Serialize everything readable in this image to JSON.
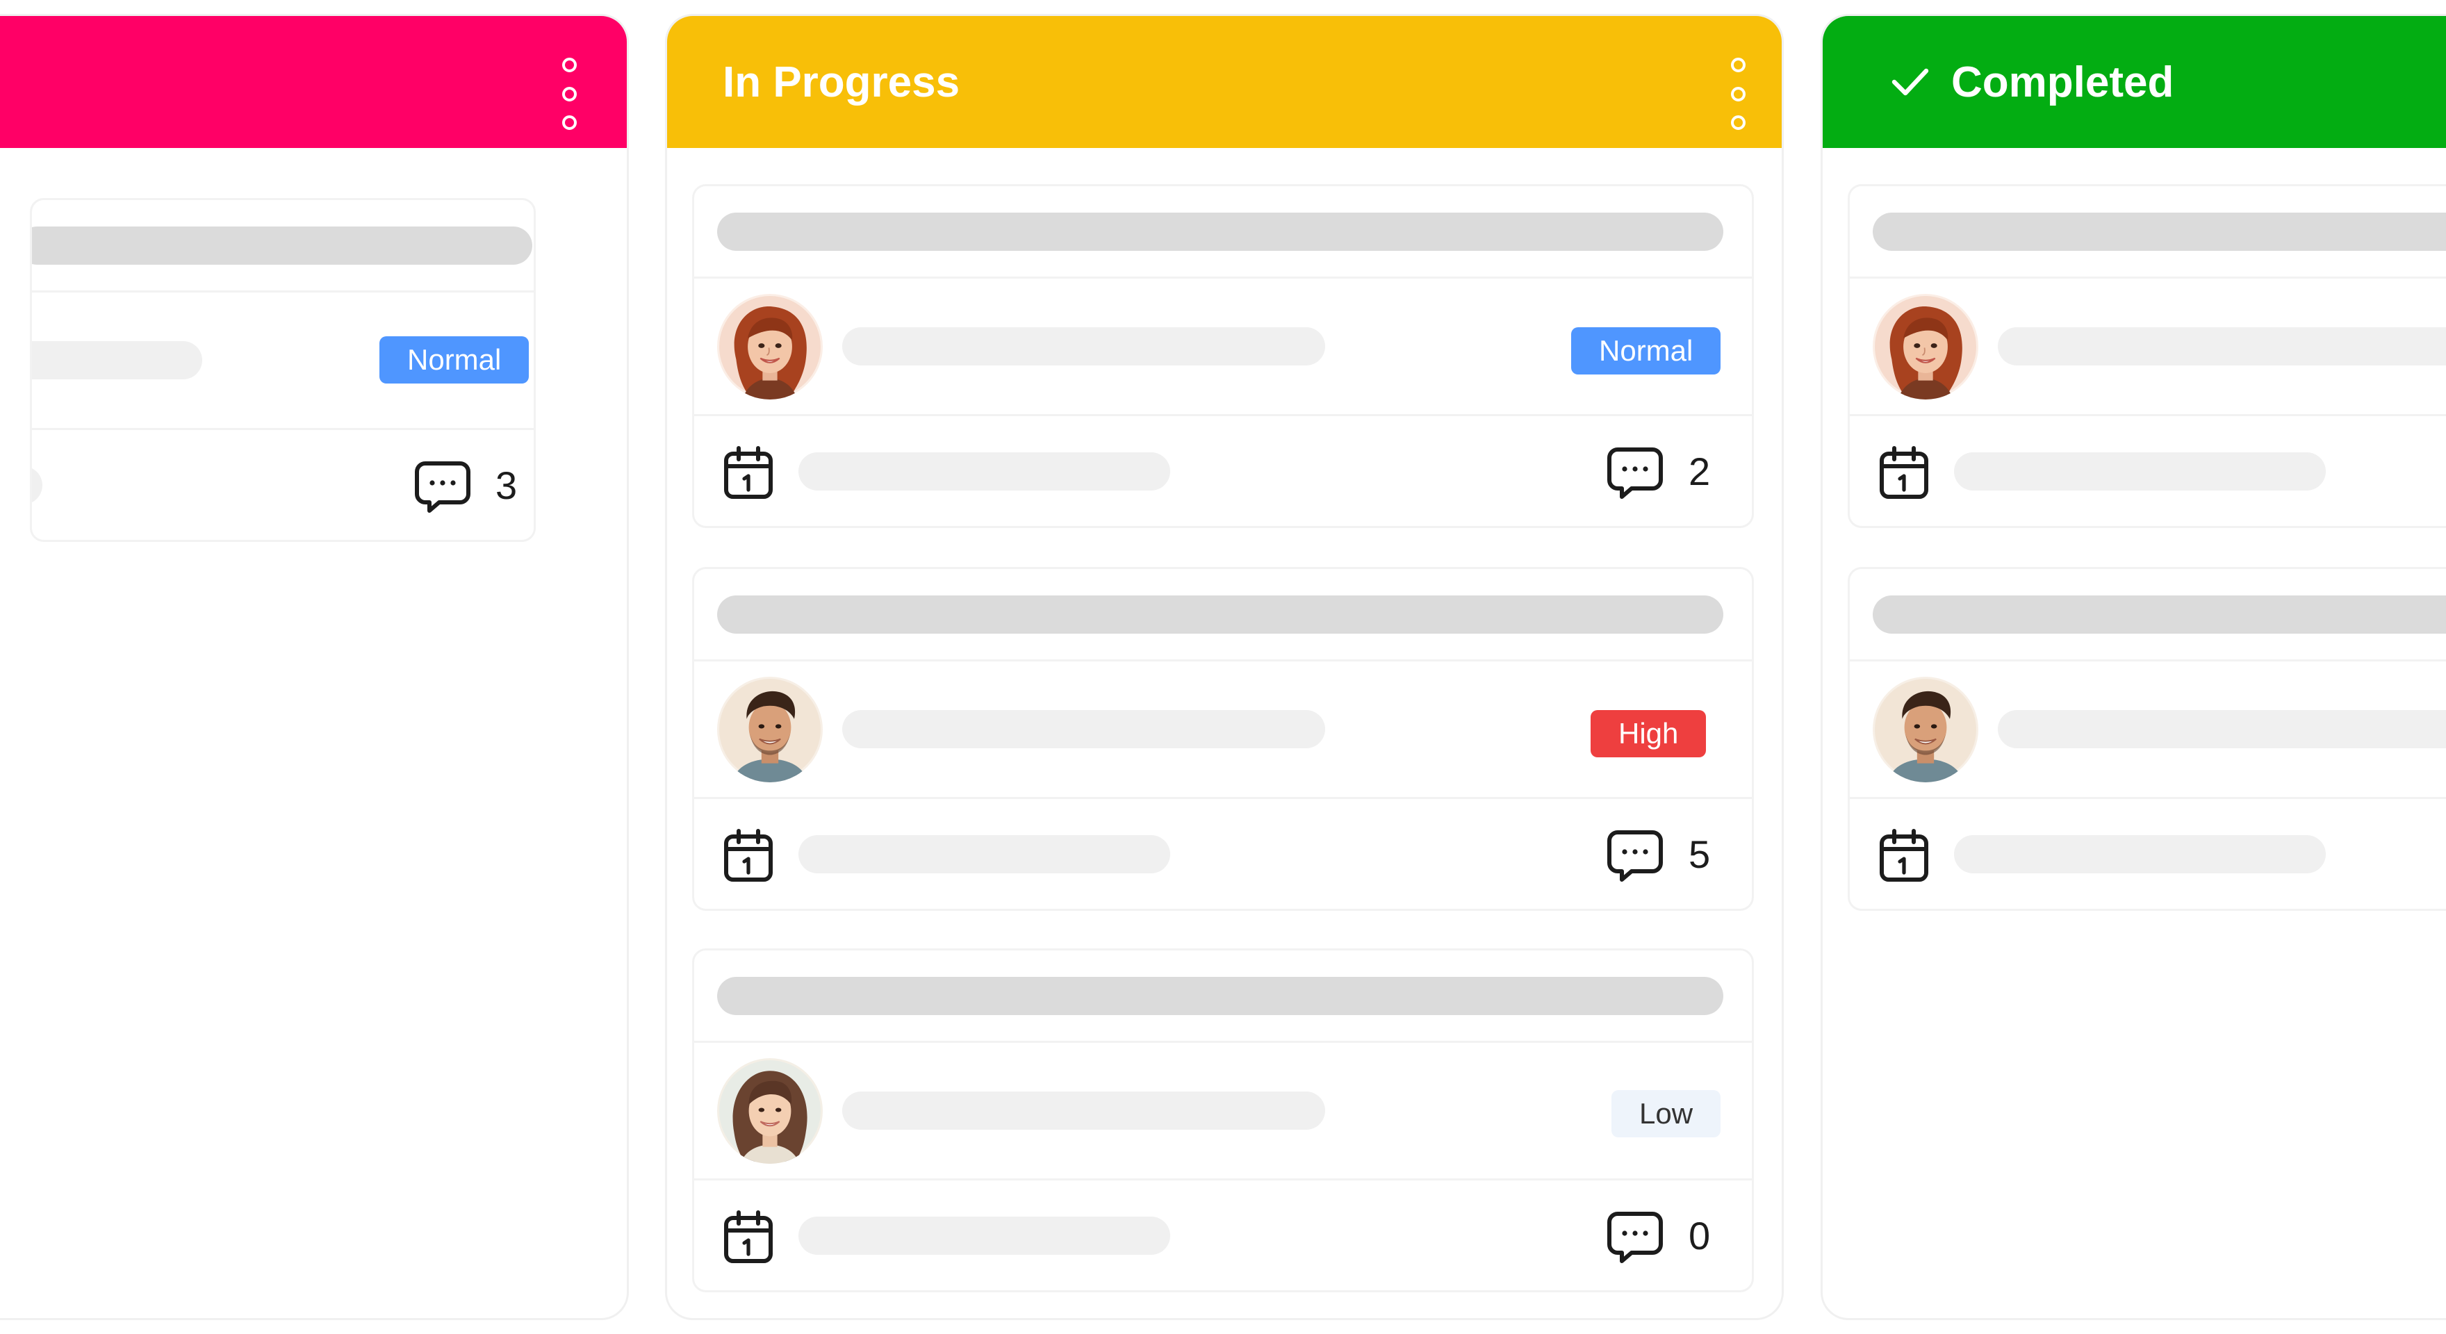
{
  "columns": {
    "todo": {
      "title": "",
      "header_color": "#ff0066",
      "cards": [
        {
          "priority": "Normal",
          "comments": "3"
        }
      ]
    },
    "in_progress": {
      "title": "In Progress",
      "header_color": "#f8bf08",
      "cards": [
        {
          "avatar": "avatar-woman-red-hair",
          "priority": "Normal",
          "comments": "2"
        },
        {
          "avatar": "avatar-man-dark-hair",
          "priority": "High",
          "comments": "5"
        },
        {
          "avatar": "avatar-woman-brown-hair",
          "priority": "Low",
          "comments": "0"
        }
      ]
    },
    "completed": {
      "title": "Completed",
      "header_color": "#03ad12",
      "header_icon": "check-icon",
      "cards": [
        {
          "avatar": "avatar-woman-red-hair"
        },
        {
          "avatar": "avatar-man-dark-hair"
        }
      ]
    }
  },
  "priority_colors": {
    "Normal": "#4f96ff",
    "High": "#ee3f3f",
    "Low": "#eef4fb"
  },
  "icons": {
    "calendar": "calendar-icon",
    "comment": "comment-icon",
    "menu": "kebab-menu-icon"
  }
}
